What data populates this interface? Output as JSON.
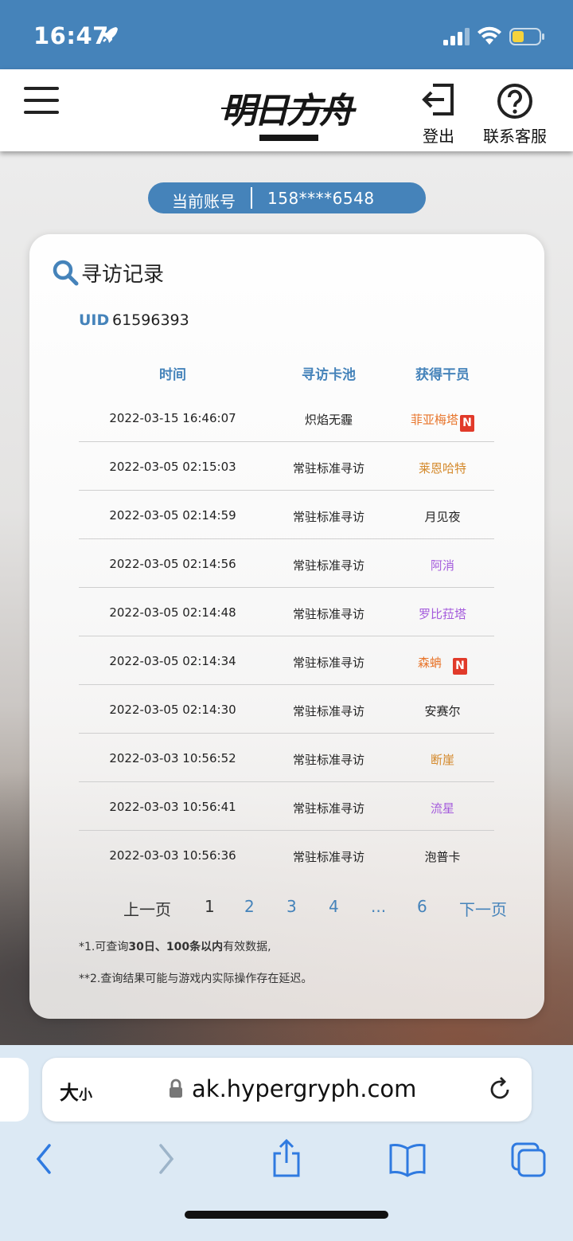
{
  "status_bar": {
    "time": "16:47",
    "icons": [
      "rocket-icon",
      "signal-icon",
      "wifi-icon",
      "battery-icon"
    ]
  },
  "header": {
    "menu_icon": "hamburger-menu-icon",
    "logo_text": "明日方舟",
    "logout_label": "登出",
    "service_label": "联系客服"
  },
  "account": {
    "label": "当前账号",
    "value": "158****6548"
  },
  "card": {
    "title": "寻访记录",
    "uid_label": "UID",
    "uid_value": "61596393",
    "columns": [
      "时间",
      "寻访卡池",
      "获得干员"
    ],
    "rows": [
      {
        "time": "2022-03-15 16:46:07",
        "pool": "炽焰无霾",
        "operator": "菲亚梅塔",
        "color": "#e8762d",
        "new": true
      },
      {
        "time": "2022-03-05 02:15:03",
        "pool": "常驻标准寻访",
        "operator": "莱恩哈特",
        "color": "#d4892b",
        "new": false
      },
      {
        "time": "2022-03-05 02:14:59",
        "pool": "常驻标准寻访",
        "operator": "月见夜",
        "color": "#222222",
        "new": false
      },
      {
        "time": "2022-03-05 02:14:56",
        "pool": "常驻标准寻访",
        "operator": "阿消",
        "color": "#a45bdc",
        "new": false
      },
      {
        "time": "2022-03-05 02:14:48",
        "pool": "常驻标准寻访",
        "operator": "罗比菈塔",
        "color": "#a45bdc",
        "new": false
      },
      {
        "time": "2022-03-05 02:14:34",
        "pool": "常驻标准寻访",
        "operator": "森蚺",
        "color": "#e8762d",
        "new": true
      },
      {
        "time": "2022-03-05 02:14:30",
        "pool": "常驻标准寻访",
        "operator": "安赛尔",
        "color": "#222222",
        "new": false
      },
      {
        "time": "2022-03-03 10:56:52",
        "pool": "常驻标准寻访",
        "operator": "断崖",
        "color": "#d4892b",
        "new": false
      },
      {
        "time": "2022-03-03 10:56:41",
        "pool": "常驻标准寻访",
        "operator": "流星",
        "color": "#a45bdc",
        "new": false
      },
      {
        "time": "2022-03-03 10:56:36",
        "pool": "常驻标准寻访",
        "operator": "泡普卡",
        "color": "#222222",
        "new": false
      }
    ],
    "new_badge": "N",
    "pagination": {
      "prev": "上一页",
      "current": "1",
      "pages": [
        "2",
        "3",
        "4"
      ],
      "ellipsis": "...",
      "last": "6",
      "next": "下一页"
    },
    "note1_prefix": "*1.可查询",
    "note1_bold": "30日、100条以内",
    "note1_suffix": "有效数据,",
    "note2": "**2.查询结果可能与游戏内实际操作存在延迟。"
  },
  "browser": {
    "text_size_label": "大",
    "text_size_small": "小",
    "url": "ak.hypergryph.com",
    "toolbar_icons": [
      "back-icon",
      "forward-icon",
      "share-icon",
      "bookmarks-icon",
      "tabs-icon"
    ]
  },
  "colors": {
    "accent": "#4583ba",
    "badge_red": "#e13a2a",
    "browser_bar": "#dce9f4"
  }
}
